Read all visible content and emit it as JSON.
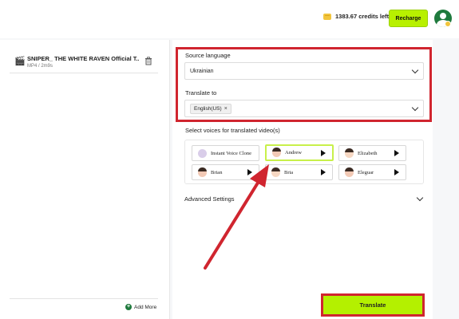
{
  "header": {
    "credits_text": "1383.67 credits left",
    "recharge_label": "Recharge"
  },
  "sidebar": {
    "file": {
      "title": "SNIPER_ THE WHITE RAVEN Official T...",
      "meta": "MP4 / 2m9s"
    },
    "add_more_label": "Add More"
  },
  "main": {
    "source_language_label": "Source language",
    "source_language_value": "Ukrainian",
    "translate_to_label": "Translate to",
    "translate_to_tag": "English(US)",
    "voices_label": "Select voices for translated video(s)",
    "voices": [
      {
        "name": "Instant Voice Clone"
      },
      {
        "name": "Andrew"
      },
      {
        "name": "Elizabeth"
      },
      {
        "name": "Brian"
      },
      {
        "name": "Bria"
      },
      {
        "name": "Eleguar"
      }
    ],
    "advanced_settings_label": "Advanced Settings",
    "translate_button_label": "Translate"
  },
  "colors": {
    "accent": "#b4f000",
    "highlight": "#d0252f",
    "brand_green": "#1f7a3d"
  }
}
